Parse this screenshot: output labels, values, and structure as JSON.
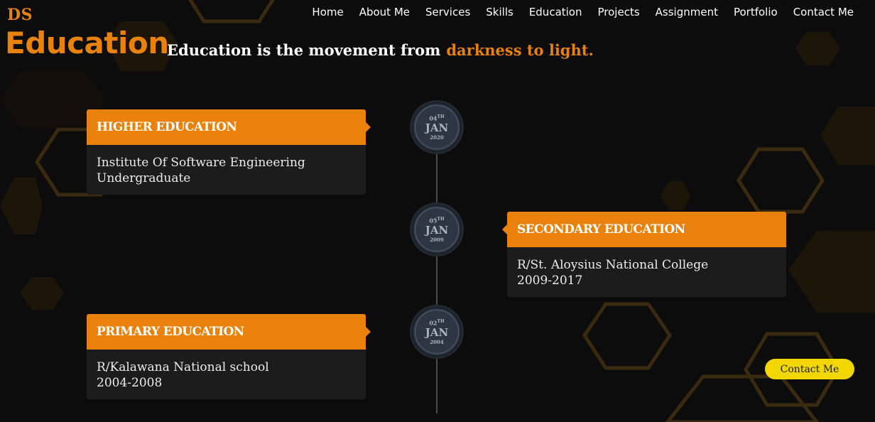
{
  "brand": {
    "logo": "DS"
  },
  "nav": {
    "items": [
      "Home",
      "About Me",
      "Services",
      "Skills",
      "Education",
      "Projects",
      "Assignment",
      "Portfolio",
      "Contact Me"
    ]
  },
  "hero": {
    "title": "Education",
    "tagline": "Education is the movement from",
    "tagline_accent": "darkness to light."
  },
  "timeline": [
    {
      "date": {
        "day": "04",
        "suffix": "TH",
        "month": "JAN",
        "year": "2020"
      },
      "heading": "HIGHER EDUCATION",
      "line1": "Institute Of Software Engineering",
      "line2": "Undergraduate",
      "side": "left"
    },
    {
      "date": {
        "day": "05",
        "suffix": "TH",
        "month": "JAN",
        "year": "2009"
      },
      "heading": "SECONDARY EDUCATION",
      "line1": "R/St. Aloysius National College",
      "line2": "2009-2017",
      "side": "right"
    },
    {
      "date": {
        "day": "02",
        "suffix": "TH",
        "month": "JAN",
        "year": "2004"
      },
      "heading": "PRIMARY EDUCATION",
      "line1": "R/Kalawana National school",
      "line2": "2004-2008",
      "side": "left"
    }
  ],
  "contact_button": {
    "label": "Contact Me"
  },
  "colors": {
    "accent": "#e8820c",
    "background": "#0d0c0c",
    "button": "#f2d600",
    "card_body": "#1c1c1c"
  }
}
